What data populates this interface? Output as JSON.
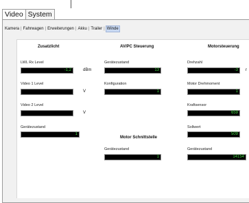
{
  "main_tabs": [
    {
      "label": "Video",
      "active": false
    },
    {
      "label": "System",
      "active": true
    }
  ],
  "sub_tabs": [
    {
      "label": "Kamera",
      "active": false
    },
    {
      "label": "Fahrwagen",
      "active": false
    },
    {
      "label": "Erweiterungen",
      "active": false
    },
    {
      "label": "Akku",
      "active": false
    },
    {
      "label": "Trailer",
      "active": false
    },
    {
      "label": "Winde",
      "active": true
    }
  ],
  "sections": {
    "zusatzlicht": {
      "title": "Zusatzlicht",
      "fields": [
        {
          "label": "LWL Rx Level",
          "value": "-1,2",
          "unit": "dBm"
        },
        {
          "label": "Video 1 Level",
          "value": "",
          "unit": "V"
        },
        {
          "label": "Video 2 Level",
          "value": "",
          "unit": "V"
        },
        {
          "label": "Gerätezustand",
          "value": "1",
          "unit": ""
        }
      ]
    },
    "avpc": {
      "title": "AV/PC Steuerung",
      "fields": [
        {
          "label": "Gerätezustand",
          "value": "13"
        },
        {
          "label": "Konfiguration",
          "value": "1"
        }
      ]
    },
    "motor_schnittstelle": {
      "title": "Motor Schnittstelle",
      "fields": [
        {
          "label": "Gerätezustand",
          "value": "1"
        }
      ]
    },
    "motorsteuerung": {
      "title": "Motorsteuerung",
      "fields": [
        {
          "label": "Drehzahl",
          "value": "-3",
          "unit": "r"
        },
        {
          "label": "Motor Drehmoment",
          "value": "1",
          "unit": ""
        },
        {
          "label": "Kraftsensor",
          "value": "659",
          "unit": ""
        },
        {
          "label": "Sollwert",
          "value": "509",
          "unit": ""
        },
        {
          "label": "Gerätezustand",
          "value": "14154",
          "unit": ""
        }
      ]
    }
  },
  "colors": {
    "value_text": "#3fd43f",
    "field_bg": "#000000",
    "active_subtab": "#c9d9f2"
  }
}
